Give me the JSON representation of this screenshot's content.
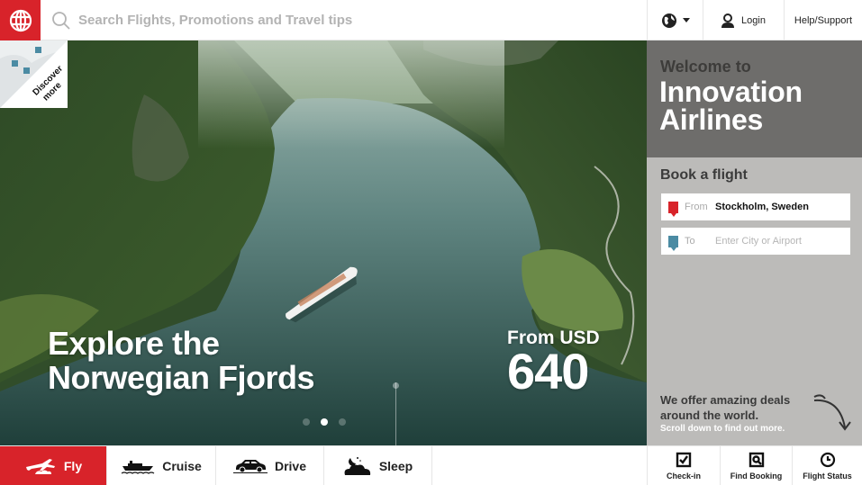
{
  "brand": {
    "logo_icon": "globe-icon",
    "primary_color": "#d8232a",
    "accent_blue": "#4b8ba3"
  },
  "header": {
    "search_placeholder": "Search Flights, Promotions and Travel tips",
    "search_icon": "search-icon",
    "language_icon": "globe-language-icon",
    "login_label": "Login",
    "login_icon": "user-icon",
    "help_label": "Help/Support"
  },
  "hero": {
    "discover_label_line1": "Discover",
    "discover_label_line2": "more",
    "title_line1": "Explore the",
    "title_line2": "Norwegian Fjords",
    "price_prefix": "From USD",
    "price_amount": "640",
    "carousel": {
      "total": 3,
      "active_index": 1
    }
  },
  "panel": {
    "welcome_small": "Welcome to",
    "welcome_line1": "Innovation",
    "welcome_line2": "Airlines",
    "book_title": "Book a flight",
    "from_label": "From",
    "from_value": "Stockholm, Sweden",
    "to_label": "To",
    "to_placeholder": "Enter City or Airport",
    "deals_line1": "We offer amazing deals",
    "deals_line2": "around the world.",
    "deals_sub": "Scroll down to find out more."
  },
  "bottom_nav": {
    "modes": [
      {
        "label": "Fly",
        "icon": "plane-icon",
        "active": true
      },
      {
        "label": "Cruise",
        "icon": "ship-icon",
        "active": false
      },
      {
        "label": "Drive",
        "icon": "car-icon",
        "active": false
      },
      {
        "label": "Sleep",
        "icon": "moon-cloud-icon",
        "active": false
      }
    ],
    "quick_actions": [
      {
        "label": "Check-in",
        "icon": "checkbox-icon"
      },
      {
        "label": "Find Booking",
        "icon": "magnifier-box-icon"
      },
      {
        "label": "Flight Status",
        "icon": "clock-icon"
      }
    ]
  }
}
